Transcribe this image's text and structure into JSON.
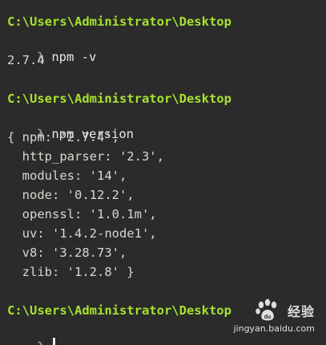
{
  "prompt_path": "C:\\Users\\Administrator\\Desktop",
  "prompt_symbol": "λ",
  "blocks": [
    {
      "command": "npm -v",
      "output": [
        "2.7.4"
      ]
    },
    {
      "command": "npm version",
      "output": [
        "{ npm: '2.7.4',",
        "  http_parser: '2.3',",
        "  modules: '14',",
        "  node: '0.12.2',",
        "  openssl: '1.0.1m',",
        "  uv: '1.4.2-node1',",
        "  v8: '3.28.73',",
        "  zlib: '1.2.8' }"
      ]
    }
  ],
  "watermark": {
    "brand": "经验",
    "url": "jingyan.baidu.com",
    "icon": "baidu-paw-icon"
  },
  "colors": {
    "background": "#2b2b2b",
    "path": "#a6e22e",
    "prompt_symbol": "#8a8a8a",
    "text": "#dcdcd4"
  }
}
